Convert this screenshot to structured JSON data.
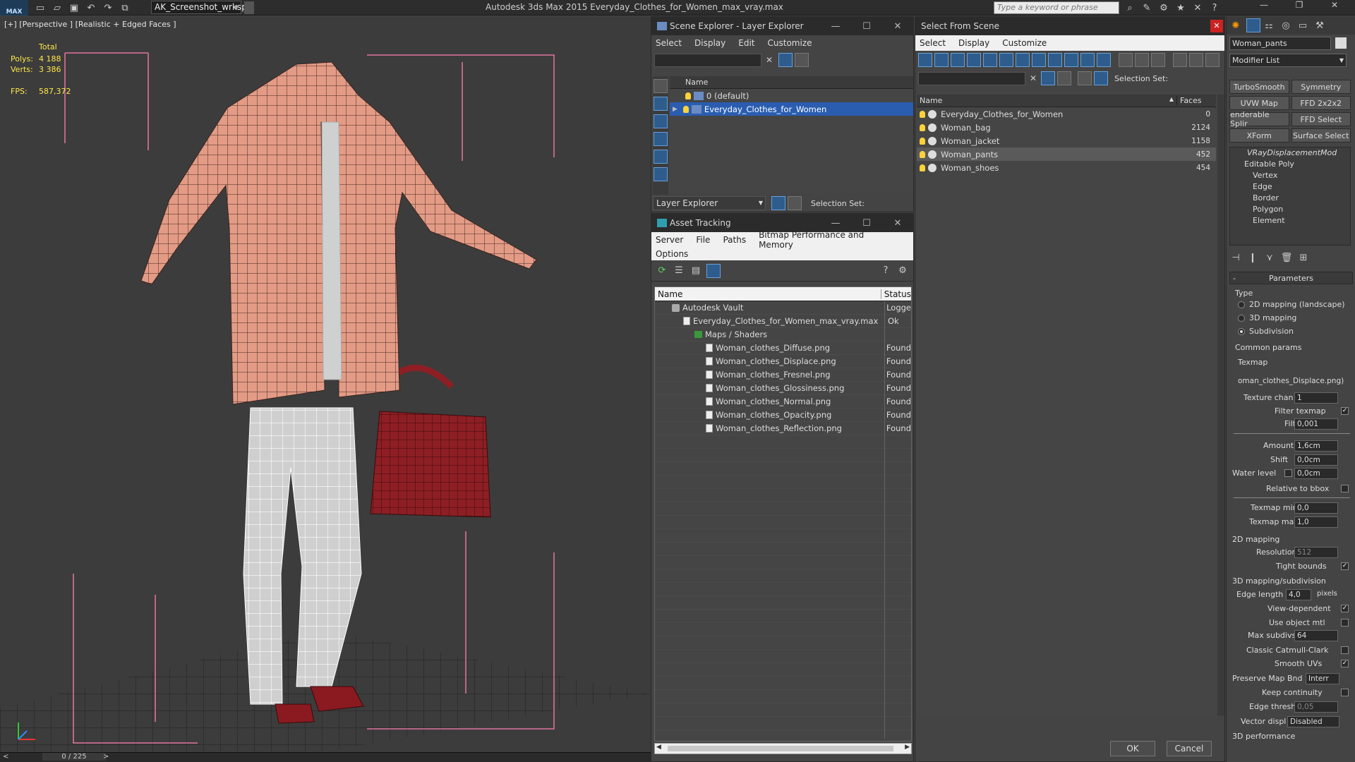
{
  "titlebar": {
    "app_badge": "MAX",
    "workspace": "AK_Screenshot_wrksp",
    "title": "Autodesk 3ds Max  2015    Everyday_Clothes_for_Women_max_vray.max",
    "search_placeholder": "Type a keyword or phrase"
  },
  "viewport": {
    "label": "[+] [Perspective ] [Realistic + Edged Faces ]",
    "stats": {
      "total_label": "Total",
      "polys_label": "Polys:",
      "polys_value": "4 188",
      "verts_label": "Verts:",
      "verts_value": "3 386",
      "fps_label": "FPS:",
      "fps_value": "587,372"
    },
    "timeline": "0 / 225"
  },
  "scene_explorer": {
    "title": "Scene Explorer - Layer Explorer",
    "menu": [
      "Select",
      "Display",
      "Edit",
      "Customize"
    ],
    "col_name": "Name",
    "rows": [
      {
        "label": "0 (default)",
        "selected": false
      },
      {
        "label": "Everyday_Clothes_for_Women",
        "selected": true
      }
    ],
    "footer_combo": "Layer Explorer",
    "selection_set": "Selection Set:"
  },
  "asset_tracking": {
    "title": "Asset Tracking",
    "menu": [
      "Server",
      "File",
      "Paths",
      "Bitmap Performance and Memory"
    ],
    "menu2": "Options",
    "col_name": "Name",
    "col_status": "Status",
    "rows": [
      {
        "name": "Autodesk Vault",
        "status": "Logge",
        "indent": 0,
        "icon": "vault"
      },
      {
        "name": "Everyday_Clothes_for_Women_max_vray.max",
        "status": "Ok",
        "indent": 1,
        "icon": "max"
      },
      {
        "name": "Maps / Shaders",
        "status": "",
        "indent": 2,
        "icon": "folder"
      },
      {
        "name": "Woman_clothes_Diffuse.png",
        "status": "Found",
        "indent": 3,
        "icon": "file"
      },
      {
        "name": "Woman_clothes_Displace.png",
        "status": "Found",
        "indent": 3,
        "icon": "file"
      },
      {
        "name": "Woman_clothes_Fresnel.png",
        "status": "Found",
        "indent": 3,
        "icon": "file"
      },
      {
        "name": "Woman_clothes_Glossiness.png",
        "status": "Found",
        "indent": 3,
        "icon": "file"
      },
      {
        "name": "Woman_clothes_Normal.png",
        "status": "Found",
        "indent": 3,
        "icon": "file"
      },
      {
        "name": "Woman_clothes_Opacity.png",
        "status": "Found",
        "indent": 3,
        "icon": "file"
      },
      {
        "name": "Woman_clothes_Reflection.png",
        "status": "Found",
        "indent": 3,
        "icon": "file"
      }
    ]
  },
  "select_from_scene": {
    "title": "Select From Scene",
    "menu": [
      "Select",
      "Display",
      "Customize"
    ],
    "selection_set": "Selection Set:",
    "col_name": "Name",
    "col_faces": "Faces",
    "rows": [
      {
        "name": "Everyday_Clothes_for_Women",
        "faces": "0",
        "selected": false
      },
      {
        "name": "Woman_bag",
        "faces": "2124",
        "selected": false
      },
      {
        "name": "Woman_jacket",
        "faces": "1158",
        "selected": false
      },
      {
        "name": "Woman_pants",
        "faces": "452",
        "selected": true
      },
      {
        "name": "Woman_shoes",
        "faces": "454",
        "selected": false
      }
    ],
    "ok": "OK",
    "cancel": "Cancel"
  },
  "command_panel": {
    "object_name": "Woman_pants",
    "modifier_list": "Modifier List",
    "buttons": [
      "TurboSmooth",
      "Symmetry",
      "UVW Map",
      "FFD 2x2x2",
      "enderable Splir",
      "FFD Select",
      "XForm",
      "Surface Select"
    ],
    "stack": [
      "VRayDisplacementMod",
      "Editable Poly",
      "Vertex",
      "Edge",
      "Border",
      "Polygon",
      "Element"
    ],
    "params": {
      "rollout": "Parameters",
      "type_label": "Type",
      "type_opts": [
        "2D mapping (landscape)",
        "3D mapping",
        "Subdivision"
      ],
      "common": "Common params",
      "texmap": "Texmap",
      "texmap_value": "oman_clothes_Displace.png)",
      "texture_chan": "Texture chan",
      "texture_chan_v": "1",
      "filter_texmap": "Filter texmap",
      "filter_blur": "Filter blur",
      "filter_blur_v": "0,001",
      "amount": "Amount",
      "amount_v": "1,6cm",
      "shift": "Shift",
      "shift_v": "0,0cm",
      "water": "Water level",
      "water_v": "0,0cm",
      "relative": "Relative to bbox",
      "tmin": "Texmap min",
      "tmin_v": "0,0",
      "tmax": "Texmap max",
      "tmax_v": "1,0",
      "map2d": "2D mapping",
      "resolution": "Resolution",
      "resolution_v": "512",
      "tight": "Tight bounds",
      "map3d": "3D mapping/subdivision",
      "edge_len": "Edge length",
      "edge_len_v": "4,0",
      "pixels": "pixels",
      "view_dep": "View-dependent",
      "use_obj": "Use object mtl",
      "max_sub": "Max subdivs",
      "max_sub_v": "64",
      "catmull": "Classic Catmull-Clark",
      "smooth_uv": "Smooth UVs",
      "preserve": "Preserve Map Bnd",
      "preserve_v": "Interr",
      "keep": "Keep continuity",
      "edge_thresh": "Edge thresh",
      "edge_thresh_v": "0,05",
      "vector": "Vector displ",
      "vector_v": "Disabled",
      "perf": "3D performance"
    }
  }
}
